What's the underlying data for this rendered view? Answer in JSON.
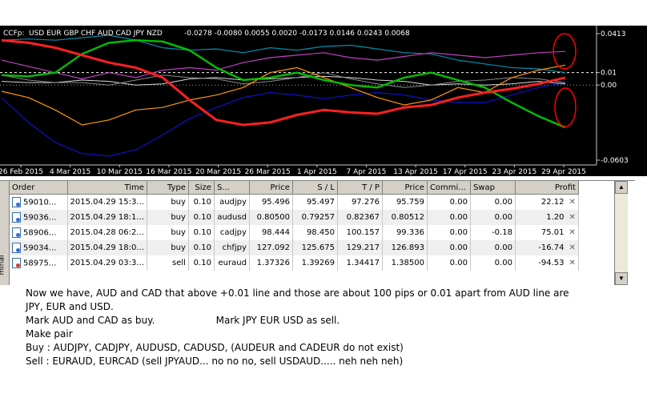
{
  "chart": {
    "header": "CCFp:",
    "series_legend": "USD EUR GBP CHF AUD CAD JPY NZD",
    "header_values": "-0.0278 -0.0080 0.0055 0.0020 -0.0173 0.0146 0.0243 0.0068",
    "y_labels": [
      "0.0413",
      "0.01",
      "0.00",
      "-0.0603"
    ],
    "x_labels": [
      "26 Feb 2015",
      "4 Mar 2015",
      "10 Mar 2015",
      "16 Mar 2015",
      "20 Mar 2015",
      "26 Mar 2015",
      "1 Apr 2015",
      "7 Apr 2015",
      "13 Apr 2015",
      "17 Apr 2015",
      "23 Apr 2015",
      "29 Apr 2015"
    ],
    "colors": {
      "background": "#000000",
      "usd": "#00c8c8",
      "eur": "#0000c8",
      "gbp": "#ff3333",
      "chf": "#c8c8c8",
      "aud": "#ffa500",
      "cad": "#c830c8",
      "jpy": "#00c000",
      "nzd": "#2080ff",
      "annotation": "#ff0000",
      "level_line": "#ffffff"
    },
    "series": [
      {
        "name": "USD",
        "color": "#008fb0",
        "width": 1.2,
        "values": [
          0.036,
          0.037,
          0.036,
          0.038,
          0.04,
          0.036,
          0.03,
          0.028,
          0.029,
          0.026,
          0.03,
          0.028,
          0.031,
          0.032,
          0.029,
          0.026,
          0.025,
          0.02,
          0.017,
          0.014,
          0.013,
          0.01
        ]
      },
      {
        "name": "EUR",
        "color": "#1010c8",
        "width": 1.2,
        "values": [
          -0.01,
          -0.03,
          -0.046,
          -0.055,
          -0.057,
          -0.052,
          -0.04,
          -0.027,
          -0.018,
          -0.01,
          -0.006,
          -0.008,
          -0.011,
          -0.008,
          -0.006,
          -0.008,
          -0.012,
          -0.014,
          -0.014,
          -0.008,
          -0.002,
          0.002
        ]
      },
      {
        "name": "GBP",
        "color": "#d8d8d8",
        "width": 1.0,
        "values": [
          0.003,
          0.002,
          0.002,
          0.004,
          0.003,
          0.0,
          0.001,
          0.005,
          0.006,
          0.004,
          0.005,
          0.006,
          0.007,
          0.006,
          0.004,
          0.003,
          0.0,
          0.001,
          0.0,
          0.001,
          0.003,
          0.001
        ]
      },
      {
        "name": "CHF",
        "color": "#8a8a8a",
        "width": 1.0,
        "values": [
          0.008,
          0.004,
          0.002,
          0.002,
          0.0,
          0.004,
          0.008,
          0.006,
          0.005,
          0.001,
          0.003,
          0.006,
          0.01,
          0.005,
          0.001,
          -0.002,
          0.0,
          0.003,
          0.004,
          0.006,
          0.005,
          0.002
        ]
      },
      {
        "name": "AUD",
        "color": "#ff9900",
        "width": 1.2,
        "values": [
          -0.005,
          -0.01,
          -0.02,
          -0.032,
          -0.028,
          -0.02,
          -0.018,
          -0.012,
          -0.008,
          -0.002,
          0.01,
          0.014,
          0.006,
          -0.002,
          -0.01,
          -0.016,
          -0.012,
          -0.002,
          -0.006,
          0.006,
          0.012,
          0.016
        ]
      },
      {
        "name": "CAD",
        "color": "#c040c0",
        "width": 1.2,
        "values": [
          0.02,
          0.015,
          0.01,
          0.005,
          0.01,
          0.006,
          0.012,
          0.014,
          0.012,
          0.018,
          0.022,
          0.024,
          0.026,
          0.022,
          0.02,
          0.023,
          0.026,
          0.024,
          0.022,
          0.024,
          0.026,
          0.027
        ]
      },
      {
        "name": "JPY",
        "color": "#00c000",
        "width": 2.4,
        "values": [
          0.008,
          0.007,
          0.01,
          0.025,
          0.034,
          0.036,
          0.035,
          0.028,
          0.014,
          0.004,
          0.006,
          0.01,
          0.004,
          0.0,
          -0.002,
          0.006,
          0.01,
          0.004,
          -0.002,
          -0.014,
          -0.025,
          -0.034
        ]
      },
      {
        "name": "NZD",
        "color": "#ff2020",
        "width": 3.0,
        "values": [
          0.036,
          0.034,
          0.03,
          0.024,
          0.018,
          0.014,
          0.006,
          -0.012,
          -0.028,
          -0.032,
          -0.03,
          -0.024,
          -0.02,
          -0.022,
          -0.023,
          -0.018,
          -0.016,
          -0.01,
          -0.006,
          -0.003,
          0.001,
          0.006
        ]
      }
    ]
  },
  "table": {
    "columns": [
      "Order",
      "Time",
      "Type",
      "Size",
      "S...",
      "Price",
      "S / L",
      "T / P",
      "Price",
      "Commi...",
      "Swap",
      "Profit"
    ],
    "rows": [
      {
        "order": "59010...",
        "time": "2015.04.29 15:3...",
        "type": "buy",
        "size": "0.10",
        "symbol": "audjpy",
        "price": "95.496",
        "sl": "95.497",
        "tp": "97.276",
        "cur": "95.759",
        "comm": "0.00",
        "swap": "0.00",
        "profit": "22.12"
      },
      {
        "order": "59036...",
        "time": "2015.04.29 18:1...",
        "type": "buy",
        "size": "0.10",
        "symbol": "audusd",
        "price": "0.80500",
        "sl": "0.79257",
        "tp": "0.82367",
        "cur": "0.80512",
        "comm": "0.00",
        "swap": "0.00",
        "profit": "1.20"
      },
      {
        "order": "58906...",
        "time": "2015.04.28 06:2...",
        "type": "buy",
        "size": "0.10",
        "symbol": "cadjpy",
        "price": "98.444",
        "sl": "98.450",
        "tp": "100.157",
        "cur": "99.336",
        "comm": "0.00",
        "swap": "-0.18",
        "profit": "75.01"
      },
      {
        "order": "59034...",
        "time": "2015.04.29 18:0...",
        "type": "buy",
        "size": "0.10",
        "symbol": "chfjpy",
        "price": "127.092",
        "sl": "125.675",
        "tp": "129.217",
        "cur": "126.893",
        "comm": "0.00",
        "swap": "0.00",
        "profit": "-16.74"
      },
      {
        "order": "58975...",
        "time": "2015.04.29 03:3...",
        "type": "sell",
        "size": "0.10",
        "symbol": "euraud",
        "price": "1.37326",
        "sl": "1.39269",
        "tp": "1.34417",
        "cur": "1.38500",
        "comm": "0.00",
        "swap": "0.00",
        "profit": "-94.53"
      }
    ],
    "side_tab_label": "minal"
  },
  "note": {
    "lines": [
      "Now we have, AUD and CAD that above +0.01 line and those are about 100 pips or 0.01 apart from AUD line are",
      "JPY, EUR and USD.",
      "Mark AUD and CAD as buy.                    Mark JPY EUR USD as sell.",
      "Make pair",
      "Buy : AUDJPY, CADJPY, AUDUSD, CADUSD, (AUDEUR and CADEUR do not exist)",
      "Sell : EURAUD, EURCAD (sell JPYAUD... no no no, sell USDAUD..... neh neh neh)"
    ]
  }
}
